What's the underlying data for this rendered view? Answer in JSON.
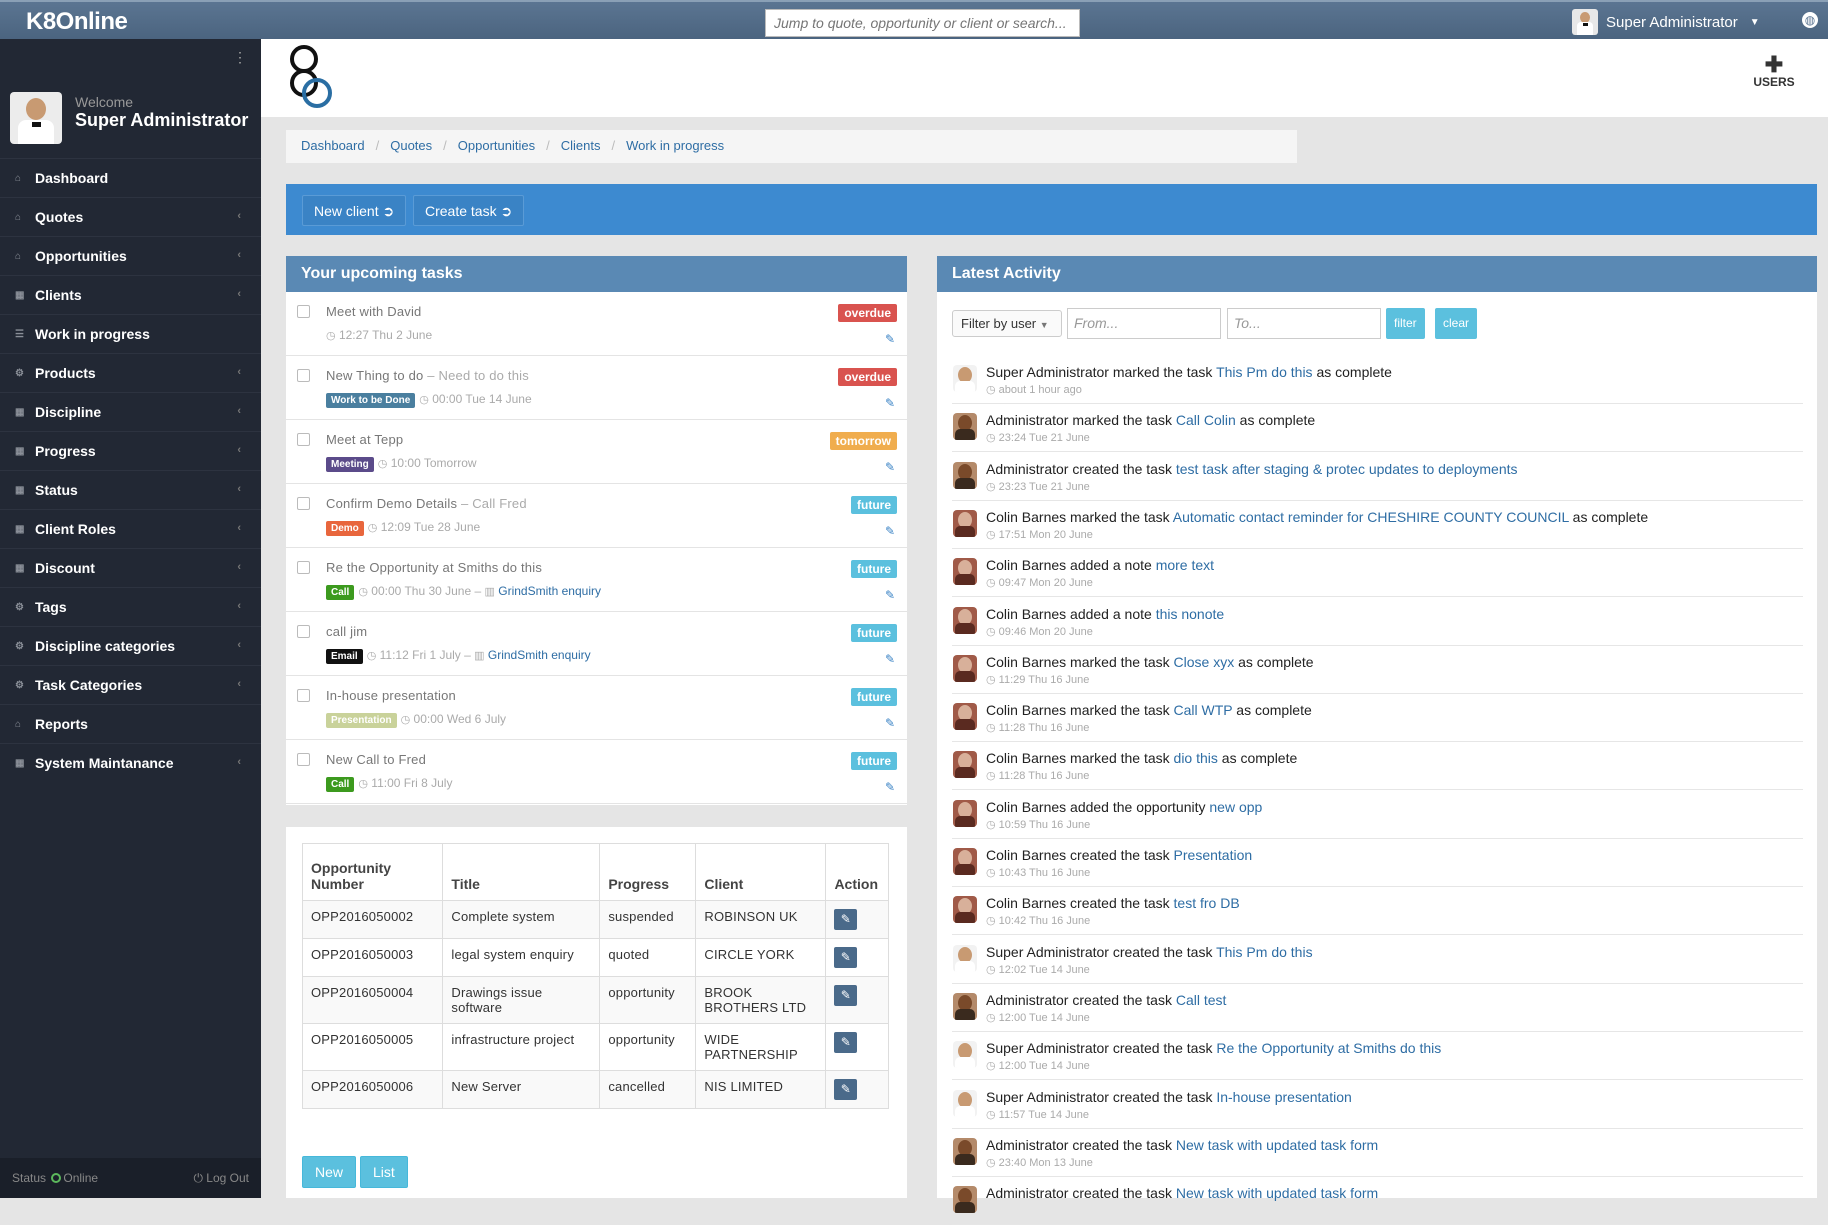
{
  "app": {
    "brand": "K8Online",
    "search_placeholder": "Jump to quote, opportunity or client or search...",
    "user": "Super Administrator"
  },
  "sidebar": {
    "welcome": "Welcome",
    "name": "Super Administrator",
    "items": [
      {
        "label": "Dashboard",
        "icon": "home-icon",
        "chevron": false
      },
      {
        "label": "Quotes",
        "icon": "home-icon",
        "chevron": true
      },
      {
        "label": "Opportunities",
        "icon": "home-icon",
        "chevron": true
      },
      {
        "label": "Clients",
        "icon": "grid-icon",
        "chevron": true
      },
      {
        "label": "Work in progress",
        "icon": "list-icon",
        "chevron": false
      },
      {
        "label": "Products",
        "icon": "cogs-icon",
        "chevron": true
      },
      {
        "label": "Discipline",
        "icon": "grid-icon",
        "chevron": true
      },
      {
        "label": "Progress",
        "icon": "grid-icon",
        "chevron": true
      },
      {
        "label": "Status",
        "icon": "grid-icon",
        "chevron": true
      },
      {
        "label": "Client Roles",
        "icon": "grid-icon",
        "chevron": true
      },
      {
        "label": "Discount",
        "icon": "grid-icon",
        "chevron": true
      },
      {
        "label": "Tags",
        "icon": "cogs-icon",
        "chevron": true
      },
      {
        "label": "Discipline categories",
        "icon": "cogs-icon",
        "chevron": true
      },
      {
        "label": "Task Categories",
        "icon": "cogs-icon",
        "chevron": true
      },
      {
        "label": "Reports",
        "icon": "home-icon",
        "chevron": false
      },
      {
        "label": "System Maintanance",
        "icon": "grid-icon",
        "chevron": true
      }
    ],
    "status_label": "Status",
    "status_value": "Online",
    "logout": "Log Out"
  },
  "header": {
    "users_label": "USERS"
  },
  "breadcrumb": [
    "Dashboard",
    "Quotes",
    "Opportunities",
    "Clients",
    "Work in progress"
  ],
  "actions": {
    "new_client": "New client",
    "create_task": "Create task"
  },
  "tasks": {
    "title": "Your upcoming tasks",
    "items": [
      {
        "title": "Meet with David",
        "sub": "",
        "tag": "",
        "tag_color": "",
        "time": "12:27 Thu 2 June",
        "link": "",
        "status": "overdue",
        "status_color": "#d9534f"
      },
      {
        "title": "New Thing to do",
        "sub": "Need to do this",
        "tag": "Work to be Done",
        "tag_color": "#4a7f9f",
        "time": "00:00 Tue 14 June",
        "link": "",
        "status": "overdue",
        "status_color": "#d9534f"
      },
      {
        "title": "Meet at Tepp",
        "sub": "",
        "tag": "Meeting",
        "tag_color": "#5b4b8a",
        "time": "10:00 Tomorrow",
        "link": "",
        "status": "tomorrow",
        "status_color": "#f0ad4e"
      },
      {
        "title": "Confirm Demo Details",
        "sub": "Call Fred",
        "tag": "Demo",
        "tag_color": "#e8663d",
        "time": "12:09 Tue 28 June",
        "link": "",
        "status": "future",
        "status_color": "#5bc0de"
      },
      {
        "title": "Re the Opportunity at Smiths do this",
        "sub": "",
        "tag": "Call",
        "tag_color": "#3c9a1e",
        "time": "00:00 Thu 30 June",
        "link": "GrindSmith enquiry",
        "status": "future",
        "status_color": "#5bc0de"
      },
      {
        "title": "call jim",
        "sub": "",
        "tag": "Email",
        "tag_color": "#111111",
        "time": "11:12 Fri 1 July",
        "link": "GrindSmith enquiry",
        "status": "future",
        "status_color": "#5bc0de"
      },
      {
        "title": "In-house presentation",
        "sub": "",
        "tag": "Presentation",
        "tag_color": "#c9d29a",
        "time": "00:00 Wed 6 July",
        "link": "",
        "status": "future",
        "status_color": "#5bc0de"
      },
      {
        "title": "New Call to Fred",
        "sub": "",
        "tag": "Call",
        "tag_color": "#3c9a1e",
        "time": "11:00 Fri 8 July",
        "link": "",
        "status": "future",
        "status_color": "#5bc0de"
      }
    ]
  },
  "opportunities": {
    "headers": [
      "Opportunity Number",
      "Title",
      "Progress",
      "Client",
      "Action"
    ],
    "rows": [
      [
        "OPP2016050002",
        "Complete system",
        "suspended",
        "ROBINSON UK"
      ],
      [
        "OPP2016050003",
        "legal system enquiry",
        "quoted",
        "CIRCLE YORK"
      ],
      [
        "OPP2016050004",
        "Drawings issue software",
        "opportunity",
        "BROOK BROTHERS LTD"
      ],
      [
        "OPP2016050005",
        "infrastructure project",
        "opportunity",
        "WIDE PARTNERSHIP"
      ],
      [
        "OPP2016050006",
        "New Server",
        "cancelled",
        "NIS LIMITED"
      ]
    ],
    "new_label": "New",
    "list_label": "List"
  },
  "activity": {
    "title": "Latest Activity",
    "filter_by_user": "Filter by user",
    "from_placeholder": "From...",
    "to_placeholder": "To...",
    "filter_label": "filter",
    "clear_label": "clear",
    "items": [
      {
        "who": "super",
        "before": "Super Administrator marked the task ",
        "link": "This Pm do this",
        "after": " as complete",
        "time": "about 1 hour ago"
      },
      {
        "who": "admin",
        "before": "Administrator marked the task ",
        "link": "Call Colin",
        "after": " as complete",
        "time": "23:24 Tue 21 June"
      },
      {
        "who": "admin",
        "before": "Administrator created the task ",
        "link": "test task after staging & protec updates to deployments",
        "after": "",
        "time": "23:23 Tue 21 June"
      },
      {
        "who": "colin",
        "before": "Colin Barnes marked the task ",
        "link": "Automatic contact reminder for CHESHIRE COUNTY COUNCIL",
        "after": " as complete",
        "time": "17:51 Mon 20 June"
      },
      {
        "who": "colin",
        "before": "Colin Barnes added a note ",
        "link": "more text",
        "after": "",
        "time": "09:47 Mon 20 June"
      },
      {
        "who": "colin",
        "before": "Colin Barnes added a note ",
        "link": "this nonote",
        "after": "",
        "time": "09:46 Mon 20 June"
      },
      {
        "who": "colin",
        "before": "Colin Barnes marked the task ",
        "link": "Close xyx",
        "after": " as complete",
        "time": "11:29 Thu 16 June"
      },
      {
        "who": "colin",
        "before": "Colin Barnes marked the task ",
        "link": "Call WTP",
        "after": " as complete",
        "time": "11:28 Thu 16 June"
      },
      {
        "who": "colin",
        "before": "Colin Barnes marked the task ",
        "link": "dio this",
        "after": " as complete",
        "time": "11:28 Thu 16 June"
      },
      {
        "who": "colin",
        "before": "Colin Barnes added the opportunity ",
        "link": "new opp",
        "after": "",
        "time": "10:59 Thu 16 June"
      },
      {
        "who": "colin",
        "before": "Colin Barnes created the task ",
        "link": "Presentation",
        "after": "",
        "time": "10:43 Thu 16 June"
      },
      {
        "who": "colin",
        "before": "Colin Barnes created the task ",
        "link": "test fro DB",
        "after": "",
        "time": "10:42 Thu 16 June"
      },
      {
        "who": "super",
        "before": "Super Administrator created the task ",
        "link": "This Pm do this",
        "after": "",
        "time": "12:02 Tue 14 June"
      },
      {
        "who": "admin",
        "before": "Administrator created the task ",
        "link": "Call test",
        "after": "",
        "time": "12:00 Tue 14 June"
      },
      {
        "who": "super",
        "before": "Super Administrator created the task ",
        "link": "Re the Opportunity at Smiths do this",
        "after": "",
        "time": "12:00 Tue 14 June"
      },
      {
        "who": "super",
        "before": "Super Administrator created the task ",
        "link": "In-house presentation",
        "after": "",
        "time": "11:57 Tue 14 June"
      },
      {
        "who": "admin",
        "before": "Administrator created the task ",
        "link": "New task with updated task form",
        "after": "",
        "time": "23:40 Mon 13 June"
      },
      {
        "who": "admin",
        "before": "Administrator created the task ",
        "link": "New task with updated task form",
        "after": "",
        "time": ""
      }
    ]
  }
}
